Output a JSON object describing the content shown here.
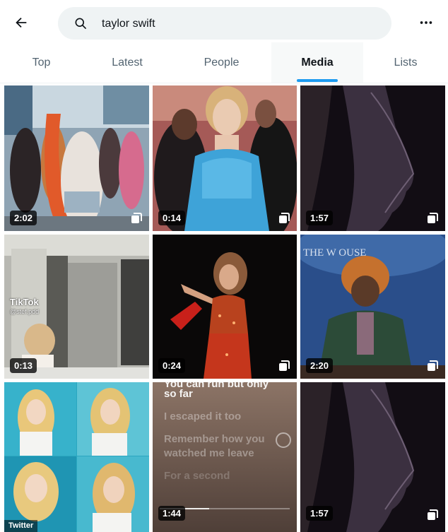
{
  "search": {
    "query": "taylor swift"
  },
  "tabs": [
    {
      "label": "Top"
    },
    {
      "label": "Latest"
    },
    {
      "label": "People"
    },
    {
      "label": "Media",
      "active": true
    },
    {
      "label": "Lists"
    }
  ],
  "tiles": [
    {
      "duration": "2:02",
      "gallery": true,
      "art": "dance-crowd"
    },
    {
      "duration": "0:14",
      "gallery": true,
      "art": "blue-gown"
    },
    {
      "duration": "1:57",
      "gallery": true,
      "art": "silhouette"
    },
    {
      "duration": "0:13",
      "gallery": false,
      "art": "tent-tiktok",
      "tiktok_label": "TikTok",
      "tiktok_user": "@stef.pdd"
    },
    {
      "duration": "0:24",
      "gallery": true,
      "art": "stage-performer"
    },
    {
      "duration": "2:20",
      "gallery": true,
      "art": "white-house-podium",
      "sign_text": "THE W   OUSE"
    },
    {
      "duration": "",
      "gallery": false,
      "art": "photo-collage"
    },
    {
      "duration": "1:44",
      "gallery": false,
      "art": "lyrics-video",
      "lyrics": {
        "top_cut": "You can run but only",
        "line1": "so far",
        "line2": "I escaped it too",
        "line3": "Remember how you",
        "line4": "watched me leave",
        "line5": "For a second"
      }
    },
    {
      "duration": "1:57",
      "gallery": true,
      "art": "silhouette"
    }
  ],
  "watermark": "Twitter",
  "colors": {
    "accent": "#1d9bf0",
    "search_bg": "#eff3f4",
    "text": "#0f1419",
    "muted": "#536471"
  }
}
